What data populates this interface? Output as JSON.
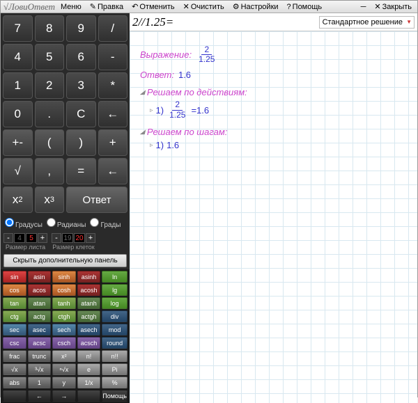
{
  "title": "√ЛовиОтвет",
  "menu": {
    "menu": "Меню",
    "edit": "Правка",
    "undo": "Отменить",
    "clear": "Очистить",
    "settings": "Настройки",
    "help": "Помощь",
    "close": "Закрыть"
  },
  "keypad": {
    "r1": [
      "7",
      "8",
      "9",
      "/"
    ],
    "r2": [
      "4",
      "5",
      "6",
      "-"
    ],
    "r3": [
      "1",
      "2",
      "3",
      "*"
    ],
    "r4": [
      "0",
      ".",
      "C",
      "←"
    ],
    "r5": [
      "+-",
      "(",
      ")",
      "+"
    ],
    "r6": [
      "√",
      ",",
      "=",
      "←"
    ],
    "r7": [
      "x²",
      "x³"
    ],
    "answer": "Ответ"
  },
  "angle": {
    "deg": "Градусы",
    "rad": "Радианы",
    "grad": "Грады"
  },
  "sizes": {
    "sheet_lbl": "Размер листа",
    "sheet": [
      "4",
      "5"
    ],
    "cell_lbl": "Размер клеток",
    "cell": [
      "19",
      "20"
    ]
  },
  "hide_extra": "Скрыть дополнительную панель",
  "sci": [
    [
      "sin",
      "asin",
      "sinh",
      "asinh",
      "ln"
    ],
    [
      "cos",
      "acos",
      "cosh",
      "acosh",
      "lg"
    ],
    [
      "tan",
      "atan",
      "tanh",
      "atanh",
      "log"
    ],
    [
      "ctg",
      "actg",
      "ctgh",
      "actgh",
      "div"
    ],
    [
      "sec",
      "asec",
      "sech",
      "asech",
      "mod"
    ],
    [
      "csc",
      "acsc",
      "csch",
      "acsch",
      "round"
    ],
    [
      "frac",
      "trunc",
      "x²",
      "n!",
      "n!!"
    ],
    [
      "√x",
      "³√x",
      "ⁿ√x",
      "e",
      "Pi"
    ],
    [
      "abs",
      "1",
      "y",
      "1/x",
      "%"
    ],
    [
      "",
      "←",
      "→",
      "",
      "Помощь"
    ]
  ],
  "expression": "2//1.25=",
  "dropdown": "Стандартное решение",
  "sheet": {
    "expr_lbl": "Выражение:",
    "expr_num": "2",
    "expr_den": "1.25",
    "ans_lbl": "Ответ:",
    "ans": "1.6",
    "by_actions": "Решаем по действиям:",
    "a1_num": "2",
    "a1_den": "1.25",
    "a1_eq": "=1.6",
    "a1_n": "1)",
    "by_steps": "Решаем по шагам:",
    "s1_n": "1)",
    "s1": "1.6"
  }
}
